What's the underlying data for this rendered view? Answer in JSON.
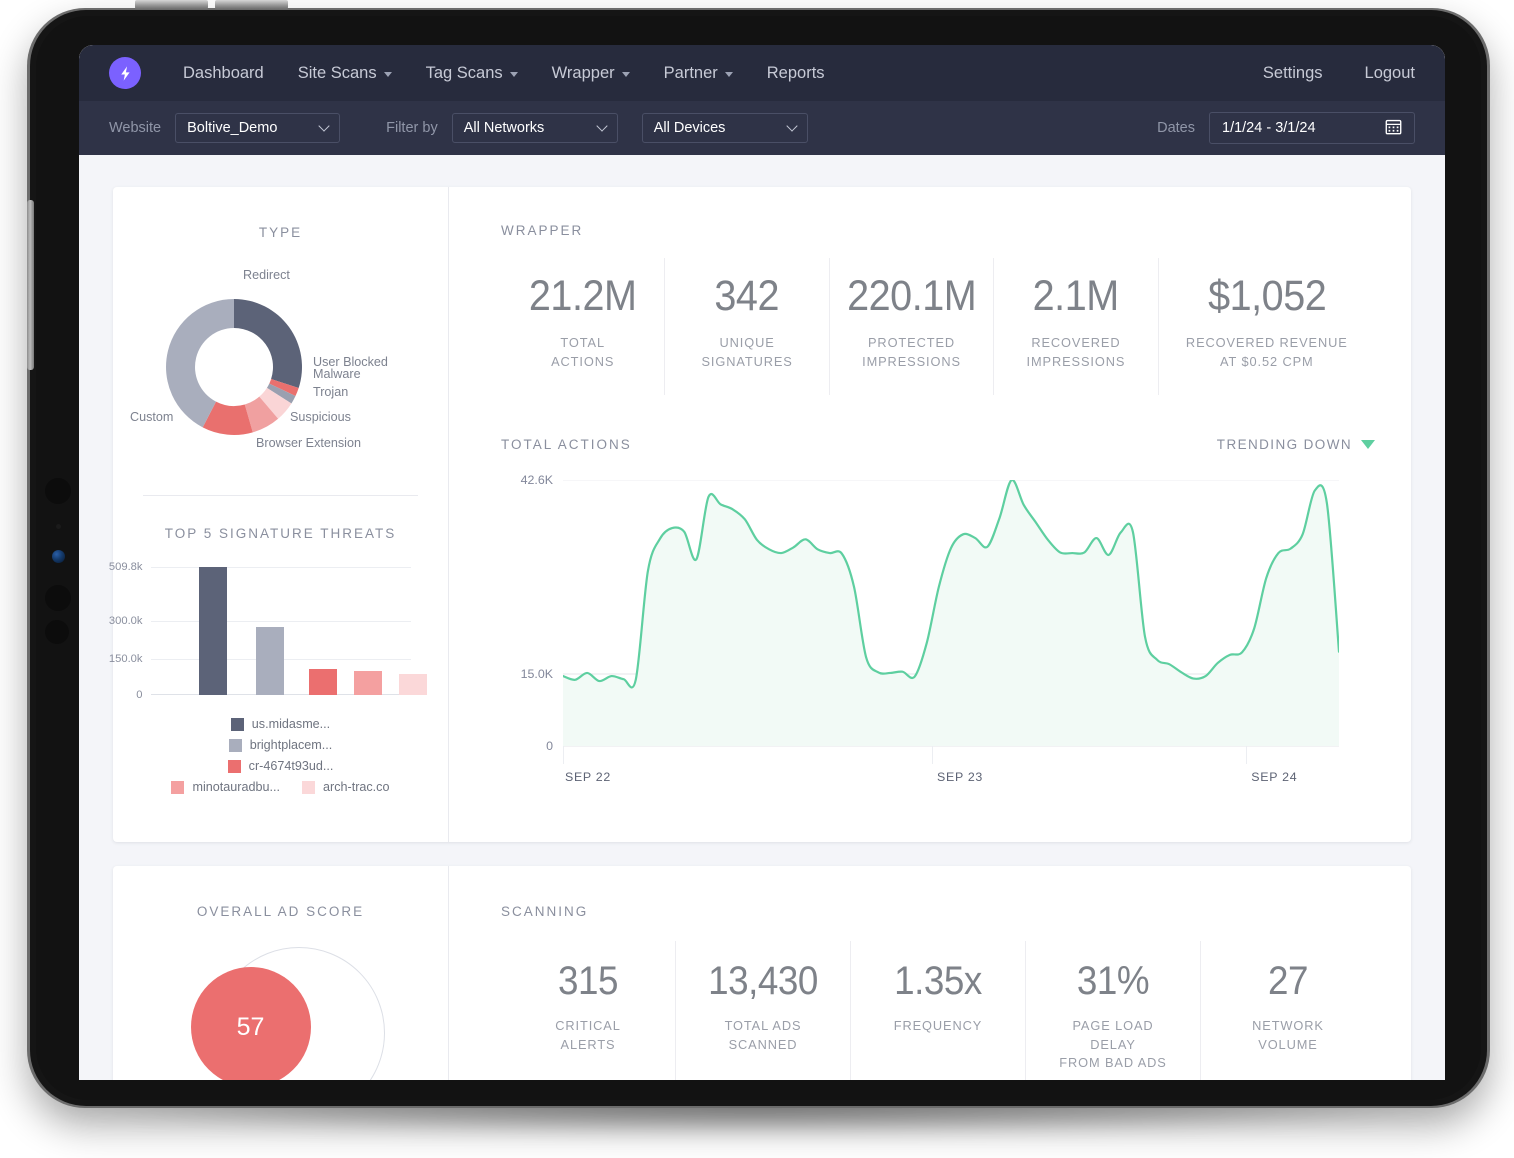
{
  "nav": {
    "logo_icon": "lightning-bolt-icon",
    "brand_color": "#7b61ff",
    "items": [
      {
        "label": "Dashboard",
        "has_caret": false
      },
      {
        "label": "Site Scans",
        "has_caret": true
      },
      {
        "label": "Tag Scans",
        "has_caret": true
      },
      {
        "label": "Wrapper",
        "has_caret": true
      },
      {
        "label": "Partner",
        "has_caret": true
      },
      {
        "label": "Reports",
        "has_caret": false
      }
    ],
    "right_items": [
      {
        "label": "Settings"
      },
      {
        "label": "Logout"
      }
    ]
  },
  "filters": {
    "website_label": "Website",
    "website_value": "Boltive_Demo",
    "filter_by_label": "Filter by",
    "networks_value": "All Networks",
    "devices_value": "All Devices",
    "dates_label": "Dates",
    "dates_value": "1/1/24  -  3/1/24",
    "calendar_icon": "calendar-icon"
  },
  "type_panel": {
    "title": "TYPE",
    "labels": {
      "redirect": "Redirect",
      "user_blocked": "User Blocked",
      "malware": "Malware",
      "trojan": "Trojan",
      "suspicious": "Suspicious",
      "browser_extension": "Browser Extension",
      "custom": "Custom"
    }
  },
  "threats_panel": {
    "title": "TOP 5 SIGNATURE THREATS",
    "y_ticks": [
      "509.8k",
      "300.0k",
      "150.0k",
      "0"
    ],
    "legend": [
      "us.midasme...",
      "brightplacem...",
      "cr-4674t93ud...",
      "minotauradbu...",
      "arch-trac.co"
    ]
  },
  "wrapper": {
    "title": "WRAPPER",
    "stats": [
      {
        "value": "21.2M",
        "label": "TOTAL\nACTIONS"
      },
      {
        "value": "342",
        "label": "UNIQUE\nSIGNATURES"
      },
      {
        "value": "220.1M",
        "label": "PROTECTED\nIMPRESSIONS"
      },
      {
        "value": "2.1M",
        "label": "RECOVERED\nIMPRESSIONS"
      },
      {
        "value": "$1,052",
        "label": "RECOVERED REVENUE\nAT $0.52 CPM"
      }
    ]
  },
  "total_actions": {
    "title": "TOTAL ACTIONS",
    "trend_label": "TRENDING DOWN",
    "trend_direction": "down",
    "trend_color": "#5ecfa0"
  },
  "ad_score": {
    "title": "OVERALL AD SCORE",
    "value": "57",
    "color": "#eb6f6f"
  },
  "scanning": {
    "title": "SCANNING",
    "stats": [
      {
        "value": "315",
        "label": "CRITICAL\nALERTS"
      },
      {
        "value": "13,430",
        "label": "TOTAL ADS\nSCANNED"
      },
      {
        "value": "1.35x",
        "label": "FREQUENCY"
      },
      {
        "value": "31%",
        "label": "PAGE LOAD\nDELAY\nFROM BAD ADS"
      },
      {
        "value": "27",
        "label": "NETWORK\nVOLUME"
      }
    ]
  },
  "chart_data": [
    {
      "type": "pie",
      "title": "TYPE",
      "legend_position": "callout-labels",
      "labels": [
        "Redirect",
        "Custom",
        "Browser Extension",
        "Suspicious",
        "Trojan",
        "Malware",
        "User Blocked"
      ],
      "values": [
        40,
        34,
        11,
        7,
        4,
        2,
        2
      ],
      "colors": [
        "#5c6378",
        "#a9aebd",
        "#e9706e",
        "#f0a0a0",
        "#fad5d6",
        "#9aa0b0",
        "#e9706e"
      ]
    },
    {
      "type": "bar",
      "title": "TOP 5 SIGNATURE THREATS",
      "categories": [
        "us.midasme...",
        "brightplacem...",
        "cr-4674t93ud...",
        "minotauradbu...",
        "arch-trac.co"
      ],
      "values": [
        509800,
        270000,
        103000,
        97000,
        85000
      ],
      "ylabel": "",
      "xlabel": "",
      "ylim": [
        0,
        509800
      ],
      "yticks": [
        0,
        150000,
        300000,
        509800
      ],
      "ytick_labels": [
        "0",
        "150.0k",
        "300.0k",
        "509.8k"
      ],
      "colors": [
        "#5c6378",
        "#a9aebd",
        "#eb6f6f",
        "#f4a0a0",
        "#fbd8d9"
      ],
      "grid": true
    },
    {
      "type": "area",
      "title": "TOTAL ACTIONS",
      "xlabel": "",
      "ylabel": "",
      "ylim": [
        0,
        42600
      ],
      "yticks": [
        0,
        15000,
        42600
      ],
      "ytick_labels": [
        "0",
        "15.0K",
        "42.6K"
      ],
      "xticks": [
        "SEP 22",
        "SEP 23",
        "SEP 24"
      ],
      "line_color": "#5ecfa0",
      "fill_color": "#f3faf6",
      "grid": true,
      "values": [
        11200,
        10600,
        11700,
        10400,
        11200,
        10700,
        10600,
        28000,
        33200,
        34900,
        34300,
        29900,
        39900,
        38700,
        37900,
        36300,
        33000,
        31500,
        30900,
        31800,
        33100,
        31500,
        30900,
        30800,
        25500,
        14200,
        11800,
        11700,
        11900,
        11100,
        16500,
        25500,
        31700,
        33900,
        33300,
        31900,
        36500,
        42600,
        38600,
        35800,
        33000,
        31000,
        30900,
        31000,
        33300,
        30600,
        34200,
        34300,
        17500,
        13800,
        13100,
        11800,
        10800,
        11200,
        13300,
        14600,
        15000,
        18800,
        26900,
        30900,
        31600,
        33900,
        40900,
        38900,
        15100
      ]
    }
  ]
}
